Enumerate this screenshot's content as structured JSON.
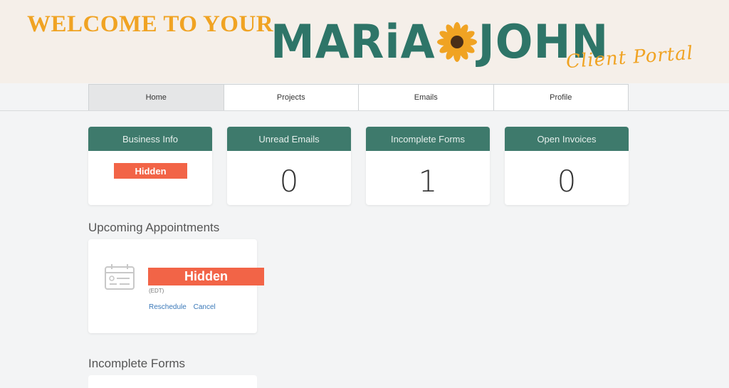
{
  "banner": {
    "welcome": "WELCOME TO YOUR",
    "brand_left": "MARiA",
    "brand_right": "JOHN",
    "portal": "Client Portal",
    "colors": {
      "background": "#f5efe9",
      "gold": "#f0a323",
      "green": "#2e7568"
    }
  },
  "nav": {
    "tabs": [
      {
        "label": "Home",
        "active": true
      },
      {
        "label": "Projects",
        "active": false
      },
      {
        "label": "Emails",
        "active": false
      },
      {
        "label": "Profile",
        "active": false
      }
    ]
  },
  "cards": [
    {
      "title": "Business Info",
      "value": "Hidden"
    },
    {
      "title": "Unread Emails",
      "value": "0"
    },
    {
      "title": "Incomplete Forms",
      "value": "1"
    },
    {
      "title": "Open Invoices",
      "value": "0"
    }
  ],
  "appointments": {
    "title": "Upcoming Appointments",
    "item": {
      "hidden_label": "Hidden",
      "timezone": "(EDT)",
      "reschedule": "Reschedule",
      "cancel": "Cancel"
    }
  },
  "forms": {
    "title": "Incomplete Forms"
  },
  "colors": {
    "card_header": "#3e7a6c",
    "redaction": "#f26447",
    "link": "#3a78b8",
    "page_bg": "#f3f4f5"
  }
}
